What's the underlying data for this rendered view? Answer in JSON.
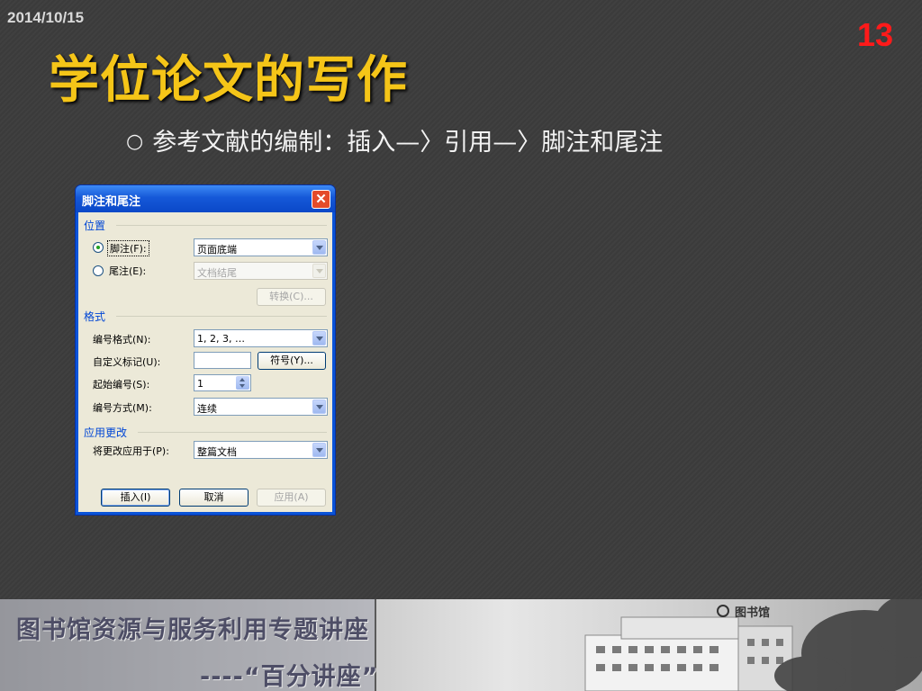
{
  "slide": {
    "date": "2014/10/15",
    "page_number": "13",
    "title": "学位论文的写作",
    "bullet_marker": "○",
    "bullet_text": "参考文献的编制：插入—〉引用—〉脚注和尾注"
  },
  "dialog": {
    "title": "脚注和尾注",
    "close_glyph": "✕",
    "section_position": "位置",
    "footnote_label": "脚注(F):",
    "footnote_value": "页面底端",
    "endnote_label": "尾注(E):",
    "endnote_value": "文档结尾",
    "convert_button": "转换(C)...",
    "section_format": "格式",
    "number_format_label": "编号格式(N):",
    "number_format_value": "1, 2, 3, …",
    "custom_mark_label": "自定义标记(U):",
    "custom_mark_value": "",
    "symbol_button": "符号(Y)...",
    "start_at_label": "起始编号(S):",
    "start_at_value": "1",
    "numbering_label": "编号方式(M):",
    "numbering_value": "连续",
    "section_apply": "应用更改",
    "apply_to_label": "将更改应用于(P):",
    "apply_to_value": "整篇文档",
    "insert_button": "插入(I)",
    "cancel_button": "取消",
    "apply_button": "应用(A)"
  },
  "banner": {
    "line1": "图书馆资源与服务利用专题讲座",
    "line2": "----“百分讲座”",
    "logo_text": "图书馆"
  },
  "colors": {
    "background": "#3c3c3c",
    "title": "#f5c518",
    "page_number": "#ff1a1a",
    "dialog_titlebar": "#0a54d8",
    "dialog_body": "#ece9d8"
  }
}
